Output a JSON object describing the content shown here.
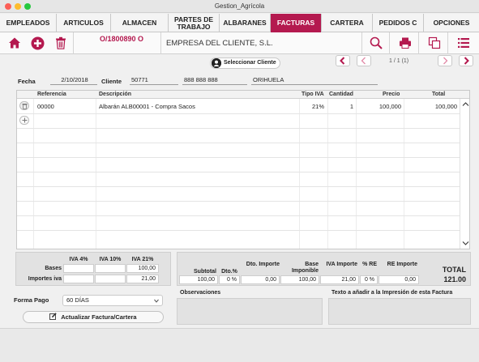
{
  "window": {
    "title": "Gestion_Agrícola"
  },
  "tabs": [
    {
      "label": "EMPLEADOS"
    },
    {
      "label": "ARTICULOS"
    },
    {
      "label": "ALMACEN"
    },
    {
      "label": "PARTES DE TRABAJO"
    },
    {
      "label": "ALBARANES"
    },
    {
      "label": "FACTURAS",
      "active": true
    },
    {
      "label": "CARTERA"
    },
    {
      "label": "PEDIDOS C"
    },
    {
      "label": "OPCIONES"
    }
  ],
  "toolbar": {
    "doc_number": "O/1800890 O",
    "empresa": "EMPRESA DEL CLIENTE, S.L.",
    "icons": [
      "home-icon",
      "add-icon",
      "trash-icon",
      "search-icon",
      "print-icon",
      "copy-icon",
      "menu-icon"
    ],
    "accent_color": "#b4194f"
  },
  "client_nav": {
    "select_client_label": "Seleccionar Cliente",
    "pager": "1 / 1 (1)"
  },
  "header": {
    "fecha_label": "Fecha",
    "fecha_value": "2/10/2018",
    "cliente_label": "Cliente",
    "cliente_code": "50771",
    "cliente_phone": "888 888 888",
    "cliente_city": "ORIHUELA"
  },
  "lines": {
    "columns": {
      "referencia": "Referencia",
      "descripcion": "Descripción",
      "tipo_iva": "Tipo IVA",
      "cantidad": "Cantidad",
      "precio": "Precio",
      "total": "Total"
    },
    "rows": [
      {
        "referencia": "00000",
        "descripcion": "Albarán ALB00001 - Compra Sacos",
        "tipo_iva": "21%",
        "cantidad": "1",
        "precio": "100,000",
        "total": "100,000"
      }
    ]
  },
  "iva_summary": {
    "col_iva4": "IVA 4%",
    "col_iva10": "IVA 10%",
    "col_iva21": "IVA 21%",
    "row_bases": "Bases",
    "row_importes": "Importes iva",
    "bases_iva4": "",
    "bases_iva10": "",
    "bases_iva21": "100,00",
    "importes_iva4": "",
    "importes_iva10": "",
    "importes_iva21": "21,00"
  },
  "totals": {
    "subtotal_label": "Subtotal",
    "dto_pct_label": "Dto.%",
    "dto_importe_label": "Dto. Importe",
    "base_imponible_label": "Base Imponible",
    "iva_importe_label": "IVA Importe",
    "re_pct_label": "% RE",
    "re_importe_label": "RE Importe",
    "total_label": "TOTAL",
    "subtotal": "100,00",
    "dto_pct": "0 %",
    "dto_importe": "0,00",
    "base_imponible": "100,00",
    "iva_importe": "21,00",
    "re_pct": "0 %",
    "re_importe": "0,00",
    "total": "121.00"
  },
  "payment": {
    "forma_pago_label": "Forma Pago",
    "forma_pago_value": "60 DÍAS",
    "update_button": "Actualizar Factura/Cartera"
  },
  "notes": {
    "observaciones_label": "Observaciones",
    "texto_label": "Texto a añadir a la Impresión de esta Factura"
  }
}
